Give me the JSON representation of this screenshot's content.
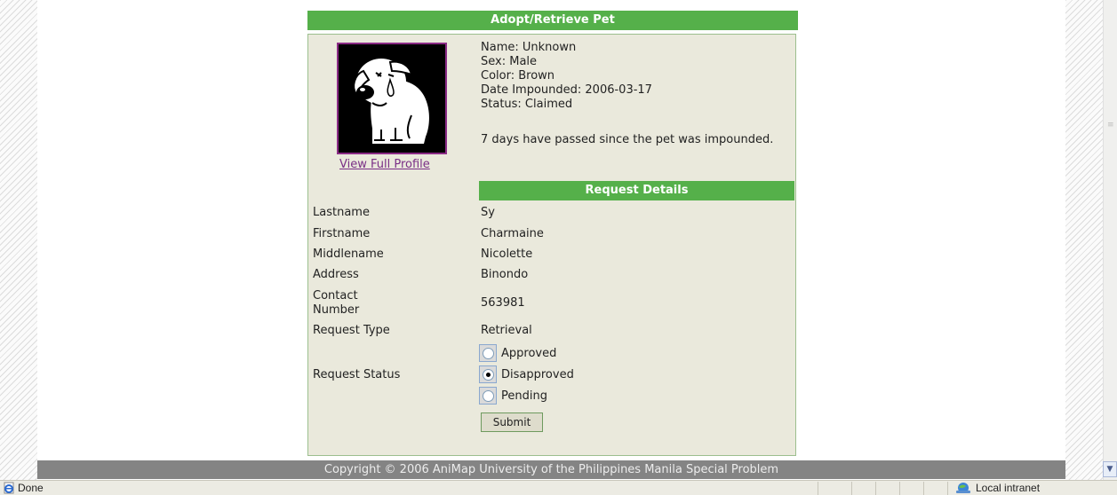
{
  "header": {
    "title": "Adopt/Retrieve Pet"
  },
  "pet": {
    "name": "Name: Unknown",
    "sex": "Sex: Male",
    "color": "Color: Brown",
    "date_impounded": "Date Impounded: 2006-03-17",
    "status": "Status: Claimed",
    "days_note": "7 days have passed since the pet was impounded.",
    "profile_link": "View Full Profile"
  },
  "request": {
    "section_title": "Request Details",
    "fields": [
      {
        "label": "Lastname",
        "value": "Sy"
      },
      {
        "label": "Firstname",
        "value": "Charmaine"
      },
      {
        "label": "Middlename",
        "value": "Nicolette"
      },
      {
        "label": "Address",
        "value": "Binondo"
      },
      {
        "label": "Contact Number",
        "value": "563981"
      },
      {
        "label": "Request Type",
        "value": "Retrieval"
      }
    ],
    "status_label": "Request Status",
    "status_options": [
      {
        "label": "Approved",
        "selected": false
      },
      {
        "label": "Disapproved",
        "selected": true
      },
      {
        "label": "Pending",
        "selected": false
      }
    ],
    "submit_label": "Submit"
  },
  "footer": {
    "copyright": "Copyright © 2006 AniMap University of the Philippines Manila Special Problem"
  },
  "statusbar": {
    "status": "Done",
    "zone": "Local intranet"
  },
  "colors": {
    "accent_green": "#55b04a",
    "panel_bg": "#eae9dc",
    "footer_gray": "#848484",
    "link_purple": "#7a2f86"
  }
}
